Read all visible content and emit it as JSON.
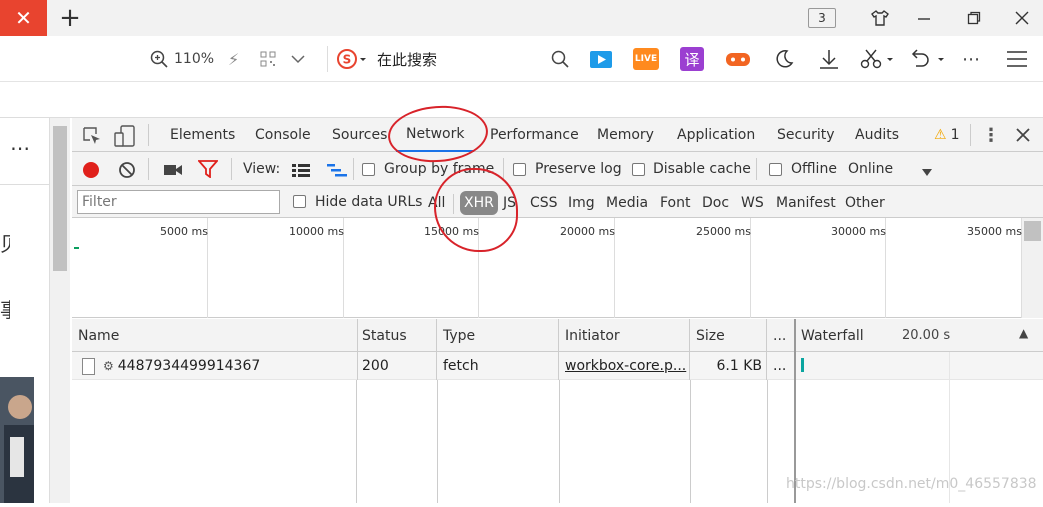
{
  "tabbar": {
    "close_icon": "close-icon",
    "new_tab_icon": "plus-icon",
    "tab_count": "3",
    "window_icons": [
      "shirt-icon",
      "minimize-icon",
      "restore-icon",
      "close-icon"
    ]
  },
  "toolbar": {
    "zoom": "110%",
    "search_placeholder": "在此搜索",
    "icons": [
      "zoom-icon",
      "lightning-icon",
      "qrcode-icon",
      "chevron-down-icon",
      "sogou-icon",
      "search-icon",
      "video-icon",
      "live-icon",
      "translate-icon",
      "game-icon",
      "moon-icon",
      "download-icon",
      "scissors-icon",
      "undo-icon",
      "more-icon",
      "menu-icon"
    ],
    "live_label": "LIVE",
    "translate_label": "译"
  },
  "left_page": {
    "dots": "⋯",
    "chars": [
      "贝",
      "事"
    ]
  },
  "devtools": {
    "tabs": [
      "Elements",
      "Console",
      "Sources",
      "Network",
      "Performance",
      "Memory",
      "Application",
      "Security",
      "Audits"
    ],
    "warning_count": "1",
    "toolbar": {
      "view_label": "View:",
      "group_by_frame": "Group by frame",
      "preserve_log": "Preserve log",
      "disable_cache": "Disable cache",
      "offline": "Offline",
      "online": "Online"
    },
    "filter": {
      "placeholder": "Filter",
      "hide_data_urls": "Hide data URLs",
      "types": [
        "All",
        "XHR",
        "JS",
        "CSS",
        "Img",
        "Media",
        "Font",
        "Doc",
        "WS",
        "Manifest",
        "Other"
      ]
    },
    "overview_ticks": [
      "5000 ms",
      "10000 ms",
      "15000 ms",
      "20000 ms",
      "25000 ms",
      "30000 ms",
      "35000 ms"
    ],
    "columns": [
      "Name",
      "Status",
      "Type",
      "Initiator",
      "Size",
      "...",
      "Waterfall"
    ],
    "waterfall_scale": "20.00 s",
    "rows": [
      {
        "name": "4487934499914367",
        "status": "200",
        "type": "fetch",
        "initiator": "workbox-core.p...",
        "size": "6.1 KB",
        "more": "..."
      }
    ]
  },
  "watermark": "https://blog.csdn.net/m0_46557838"
}
